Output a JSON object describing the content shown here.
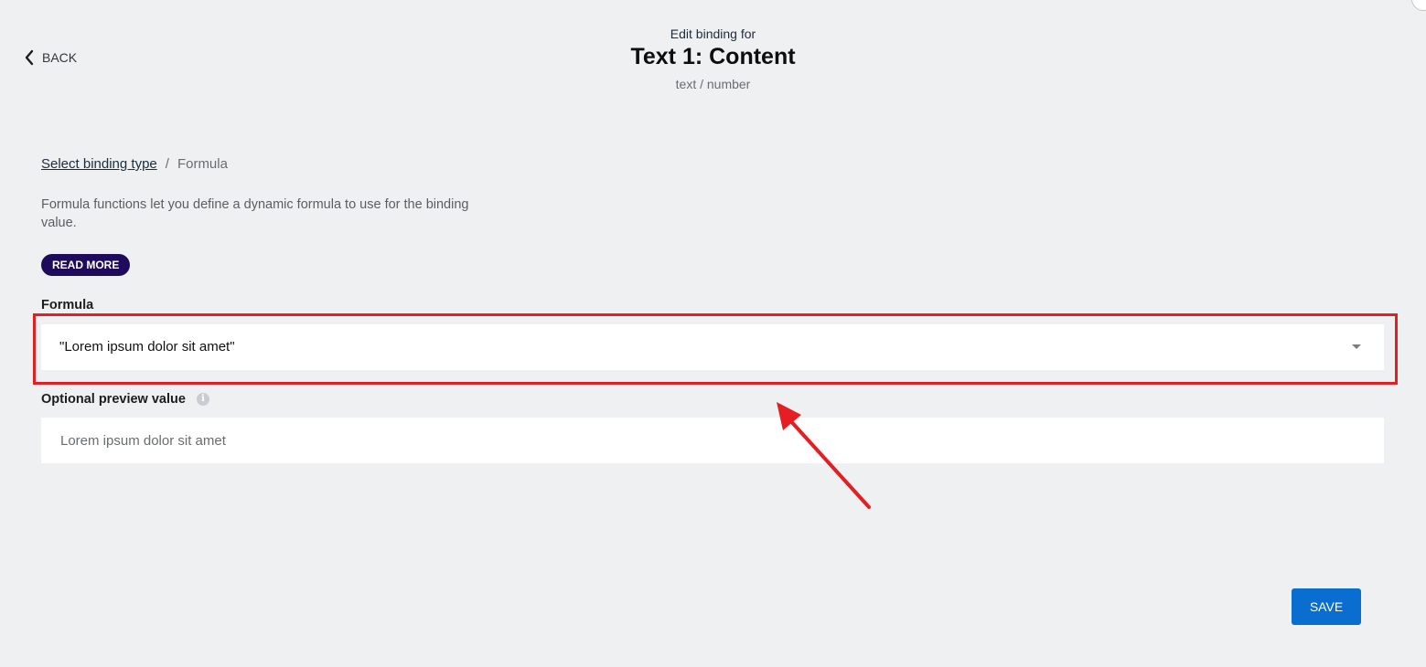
{
  "nav": {
    "back_label": "BACK"
  },
  "header": {
    "eyebrow": "Edit binding for",
    "title": "Text 1: Content",
    "subtitle": "text / number"
  },
  "breadcrumb": {
    "link": "Select binding type",
    "separator": "/",
    "current": "Formula"
  },
  "description": "Formula functions let you define a dynamic formula to use for the binding value.",
  "read_more_label": "READ MORE",
  "formula": {
    "label": "Formula",
    "value": "\"Lorem ipsum dolor sit amet\""
  },
  "preview": {
    "label": "Optional preview value",
    "placeholder": "Lorem ipsum dolor sit amet"
  },
  "save_label": "SAVE",
  "colors": {
    "background": "#eff0f2",
    "read_more_bg": "#1e0b5b",
    "save_bg": "#0a6ed1",
    "annotation": "#e41e22"
  }
}
